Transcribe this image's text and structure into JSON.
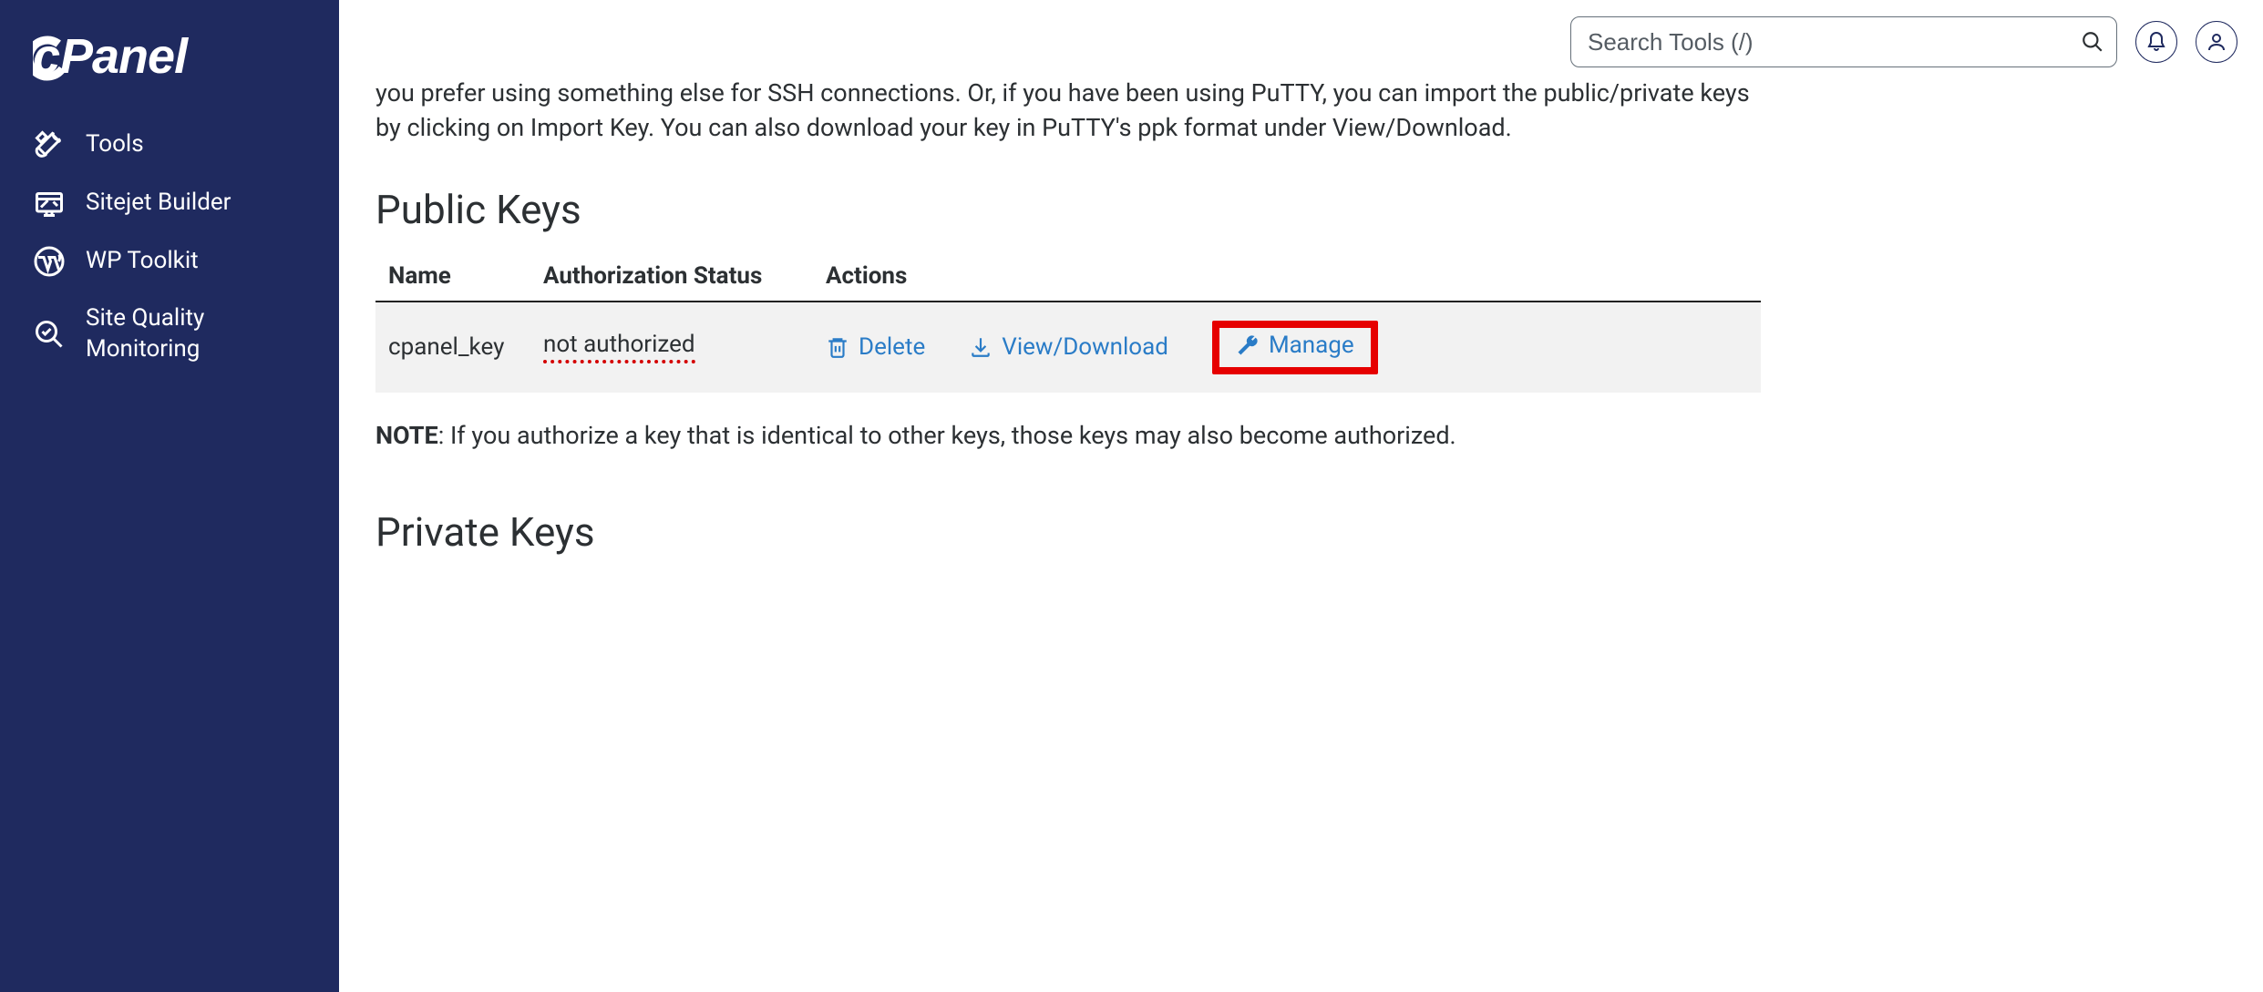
{
  "brand": {
    "name": "cPanel"
  },
  "sidebar": {
    "items": [
      {
        "label": "Tools",
        "icon": "tools"
      },
      {
        "label": "Sitejet Builder",
        "icon": "sitejet"
      },
      {
        "label": "WP Toolkit",
        "icon": "wordpress"
      },
      {
        "label": "Site Quality Monitoring",
        "icon": "magnify-check"
      }
    ]
  },
  "topbar": {
    "search_placeholder": "Search Tools (/)"
  },
  "intro": {
    "text": "you prefer using something else for SSH connections. Or, if you have been using PuTTY, you can import the public/private keys by clicking on Import Key. You can also download your key in PuTTY's ppk format under View/Download."
  },
  "public_keys": {
    "heading": "Public Keys",
    "columns": {
      "name": "Name",
      "auth": "Authorization Status",
      "actions": "Actions"
    },
    "rows": [
      {
        "name": "cpanel_key",
        "auth_status": "not authorized",
        "actions": {
          "delete": "Delete",
          "view_download": "View/Download",
          "manage": "Manage"
        }
      }
    ]
  },
  "note": {
    "label": "NOTE",
    "text": ": If you authorize a key that is identical to other keys, those keys may also become authorized."
  },
  "private_keys": {
    "heading": "Private Keys"
  }
}
